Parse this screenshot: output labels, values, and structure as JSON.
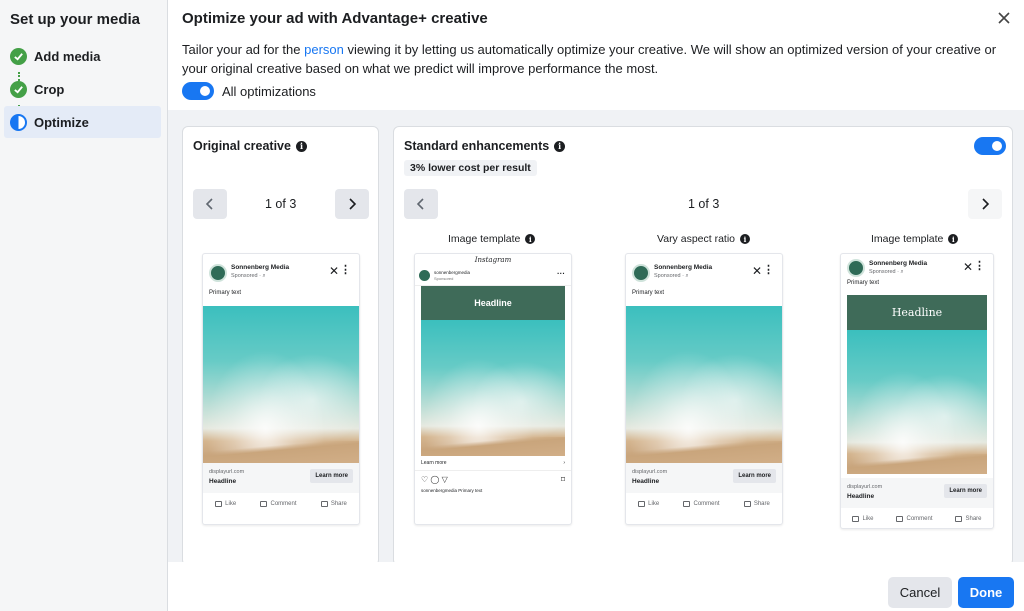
{
  "sidebar": {
    "title": "Set up your media",
    "steps": [
      {
        "label": "Add media",
        "state": "done"
      },
      {
        "label": "Crop",
        "state": "done"
      },
      {
        "label": "Optimize",
        "state": "active"
      }
    ]
  },
  "dialog": {
    "title": "Optimize your ad with Advantage+ creative",
    "desc_before": "Tailor your ad for the ",
    "desc_link": "person",
    "desc_after": " viewing it by letting us automatically optimize your creative. We will show an optimized version of your creative or your original creative based on what we predict will improve performance the most.",
    "toggle_label": "All optimizations",
    "toggle_on": true
  },
  "original": {
    "title": "Original creative",
    "pager": "1 of 3"
  },
  "standard": {
    "title": "Standard enhancements",
    "badge": "3% lower cost per result",
    "pager": "1 of 3",
    "toggle_on": true,
    "cards": [
      {
        "label": "Image template"
      },
      {
        "label": "Vary aspect ratio"
      },
      {
        "label": "Image template"
      }
    ]
  },
  "ad": {
    "page_name": "Sonnenberg Media",
    "sponsored": "Sponsored · ⌕",
    "primary_text": "Primary text",
    "url": "displayurl.com",
    "headline": "Headline",
    "cta": "Learn more",
    "like": "Like",
    "comment": "Comment",
    "share": "Share",
    "band_headline": "Headline"
  },
  "insta": {
    "logo": "Instagram",
    "account": "sonnenbergmedia",
    "sponsored": "Sponsored",
    "learn": "Learn more",
    "caption": "sonnenbergmedia Primary text"
  },
  "buttons": {
    "cancel": "Cancel",
    "done": "Done"
  },
  "colors": {
    "accent": "#1877f2",
    "success": "#44a047",
    "band": "#3f6b59"
  }
}
